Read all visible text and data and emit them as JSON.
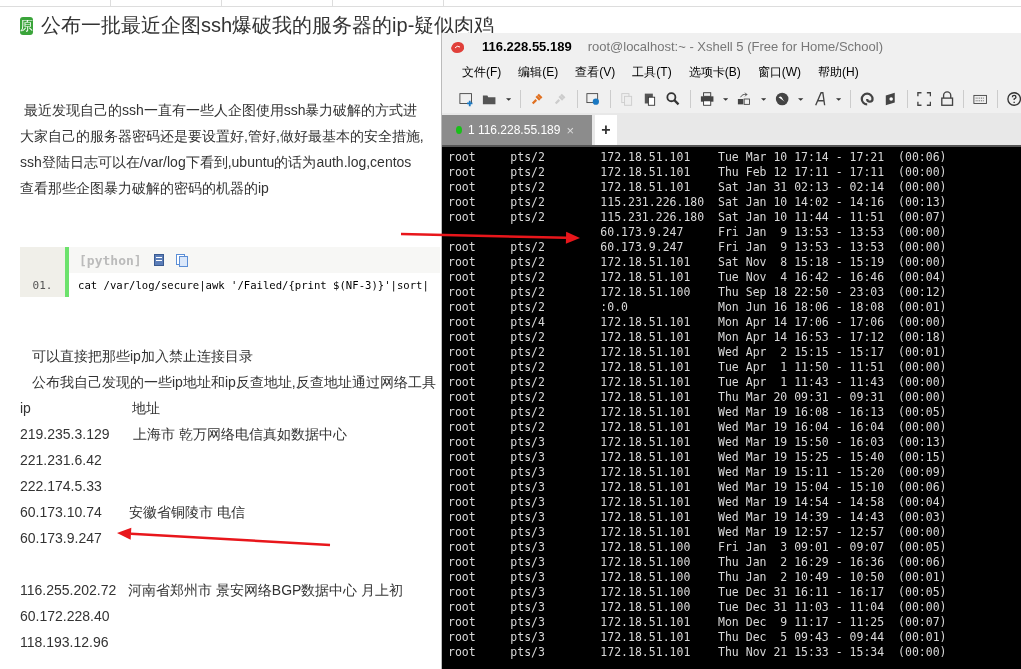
{
  "article": {
    "badge": "原",
    "title": "公布一批最近企图ssh爆破我的服务器的ip-疑似肉鸡",
    "intro_lines": [
      " 最近发现自己的ssh一直有一些人企图使用ssh暴力破解的方式进",
      "大家自己的服务器密码还是要设置好,管好,做好最基本的安全措施,",
      "ssh登陆日志可以在/var/log下看到,ubuntu的话为auth.log,centos",
      "查看那些企图暴力破解的密码的机器的ip"
    ],
    "code_block": {
      "language": "[python]",
      "lines": [
        {
          "number": "01.",
          "code": "cat /var/log/secure|awk '/Failed/{print $(NF-3)}'|sort|"
        }
      ]
    },
    "after_lines": [
      "可以直接把那些ip加入禁止连接目录",
      "公布我自己发现的一些ip地址和ip反查地址,反查地址通过网络工具"
    ],
    "ip_table": {
      "header": "ip                          地址",
      "blocks": [
        [
          "219.235.3.129      上海市 乾万网络电信真如数据中心",
          "221.231.6.42",
          "222.174.5.33",
          "60.173.10.74       安徽省铜陵市 电信",
          "60.173.9.247"
        ],
        [
          "116.255.202.72   河南省郑州市 景安网络BGP数据中心 月上初",
          "60.172.228.40",
          "118.193.12.96"
        ]
      ]
    }
  },
  "xshell": {
    "host": "116.228.55.189",
    "title": "root@localhost:~ - Xshell 5 (Free for Home/School)",
    "menu": [
      "文件(F)",
      "编辑(E)",
      "查看(V)",
      "工具(T)",
      "选项卡(B)",
      "窗口(W)",
      "帮助(H)"
    ],
    "tabs": [
      {
        "index": "1",
        "label": "116.228.55.189",
        "selected": true,
        "connected": true,
        "close": "×"
      }
    ],
    "new_tab": "+",
    "terminal_lines": [
      "root     pts/2        172.18.51.101    Tue Mar 10 17:14 - 17:21  (00:06)",
      "root     pts/2        172.18.51.101    Thu Feb 12 17:11 - 17:11  (00:00)",
      "root     pts/2        172.18.51.101    Sat Jan 31 02:13 - 02:14  (00:00)",
      "root     pts/2        115.231.226.180  Sat Jan 10 14:02 - 14:16  (00:13)",
      "root     pts/2        115.231.226.180  Sat Jan 10 11:44 - 11:51  (00:07)",
      "                      60.173.9.247     Fri Jan  9 13:53 - 13:53  (00:00)",
      "root     pts/2        60.173.9.247     Fri Jan  9 13:53 - 13:53  (00:00)",
      "root     pts/2        172.18.51.101    Sat Nov  8 15:18 - 15:19  (00:00)",
      "root     pts/2        172.18.51.101    Tue Nov  4 16:42 - 16:46  (00:04)",
      "root     pts/2        172.18.51.100    Thu Sep 18 22:50 - 23:03  (00:12)",
      "root     pts/2        :0.0             Mon Jun 16 18:06 - 18:08  (00:01)",
      "root     pts/4        172.18.51.101    Mon Apr 14 17:06 - 17:06  (00:00)",
      "root     pts/2        172.18.51.101    Mon Apr 14 16:53 - 17:12  (00:18)",
      "root     pts/2        172.18.51.101    Wed Apr  2 15:15 - 15:17  (00:01)",
      "root     pts/2        172.18.51.101    Tue Apr  1 11:50 - 11:51  (00:00)",
      "root     pts/2        172.18.51.101    Tue Apr  1 11:43 - 11:43  (00:00)",
      "root     pts/2        172.18.51.101    Thu Mar 20 09:31 - 09:31  (00:00)",
      "root     pts/2        172.18.51.101    Wed Mar 19 16:08 - 16:13  (00:05)",
      "root     pts/2        172.18.51.101    Wed Mar 19 16:04 - 16:04  (00:00)",
      "root     pts/3        172.18.51.101    Wed Mar 19 15:50 - 16:03  (00:13)",
      "root     pts/3        172.18.51.101    Wed Mar 19 15:25 - 15:40  (00:15)",
      "root     pts/3        172.18.51.101    Wed Mar 19 15:11 - 15:20  (00:09)",
      "root     pts/3        172.18.51.101    Wed Mar 19 15:04 - 15:10  (00:06)",
      "root     pts/3        172.18.51.101    Wed Mar 19 14:54 - 14:58  (00:04)",
      "root     pts/3        172.18.51.101    Wed Mar 19 14:39 - 14:43  (00:03)",
      "root     pts/3        172.18.51.101    Wed Mar 19 12:57 - 12:57  (00:00)",
      "root     pts/3        172.18.51.100    Fri Jan  3 09:01 - 09:07  (00:05)",
      "root     pts/3        172.18.51.100    Thu Jan  2 16:29 - 16:36  (00:06)",
      "root     pts/3        172.18.51.100    Thu Jan  2 10:49 - 10:50  (00:01)",
      "root     pts/3        172.18.51.100    Tue Dec 31 16:11 - 16:17  (00:05)",
      "root     pts/3        172.18.51.100    Tue Dec 31 11:03 - 11:04  (00:00)",
      "root     pts/3        172.18.51.101    Mon Dec  9 11:17 - 11:25  (00:07)",
      "root     pts/3        172.18.51.101    Thu Dec  5 09:43 - 09:44  (00:01)",
      "root     pts/3        172.18.51.101    Thu Nov 21 15:33 - 15:34  (00:00)"
    ]
  }
}
